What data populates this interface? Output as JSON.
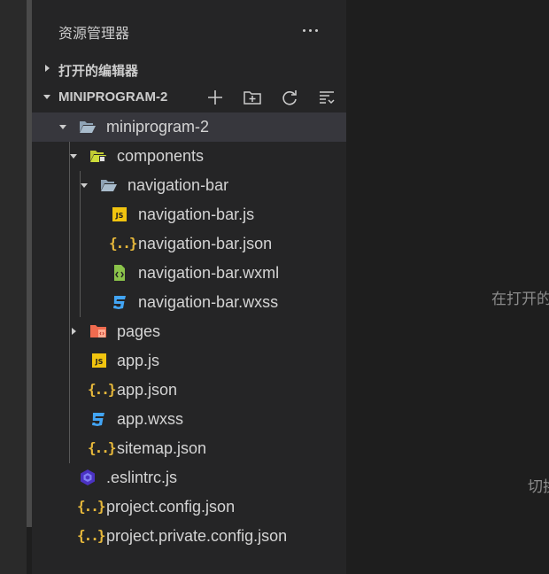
{
  "explorer": {
    "title": "资源管理器",
    "more_icon": "ellipsis-icon"
  },
  "open_editors": {
    "label": "打开的编辑器"
  },
  "project": {
    "label": "MINIPROGRAM-2",
    "toolbar": [
      "new-file-icon",
      "new-folder-icon",
      "refresh-icon",
      "collapse-all-icon"
    ]
  },
  "tree": [
    {
      "label": "miniprogram-2",
      "icon": "folder-open-icon"
    },
    {
      "label": "components",
      "icon": "components-folder-icon"
    },
    {
      "label": "navigation-bar",
      "icon": "folder-open-icon"
    },
    {
      "label": "navigation-bar.js",
      "icon": "js-file-icon"
    },
    {
      "label": "navigation-bar.json",
      "icon": "json-file-icon"
    },
    {
      "label": "navigation-bar.wxml",
      "icon": "wxml-file-icon"
    },
    {
      "label": "navigation-bar.wxss",
      "icon": "wxss-file-icon"
    },
    {
      "label": "pages",
      "icon": "pages-folder-icon"
    },
    {
      "label": "app.js",
      "icon": "js-file-icon"
    },
    {
      "label": "app.json",
      "icon": "json-file-icon"
    },
    {
      "label": "app.wxss",
      "icon": "wxss-file-icon"
    },
    {
      "label": "sitemap.json",
      "icon": "json-file-icon"
    },
    {
      "label": ".eslintrc.js",
      "icon": "eslint-file-icon"
    },
    {
      "label": "project.config.json",
      "icon": "json-file-icon"
    },
    {
      "label": "project.private.config.json",
      "icon": "json-file-icon"
    }
  ],
  "icons": {
    "js_badge": "JS",
    "json_badge": "{..}"
  },
  "editor": {
    "hint_1": "在打开的",
    "hint_2": "切换"
  },
  "colors": {
    "sidebar": "#252526",
    "editor": "#1e1e1e",
    "selected_row": "#37373d",
    "folder": "#8fa3b5",
    "json": "#e8b93b",
    "js": "#f1c40f",
    "wxss": "#42a5f5",
    "wxml": "#8bc34a",
    "pages": "#f06b4f",
    "eslint": "#4b32c3"
  }
}
